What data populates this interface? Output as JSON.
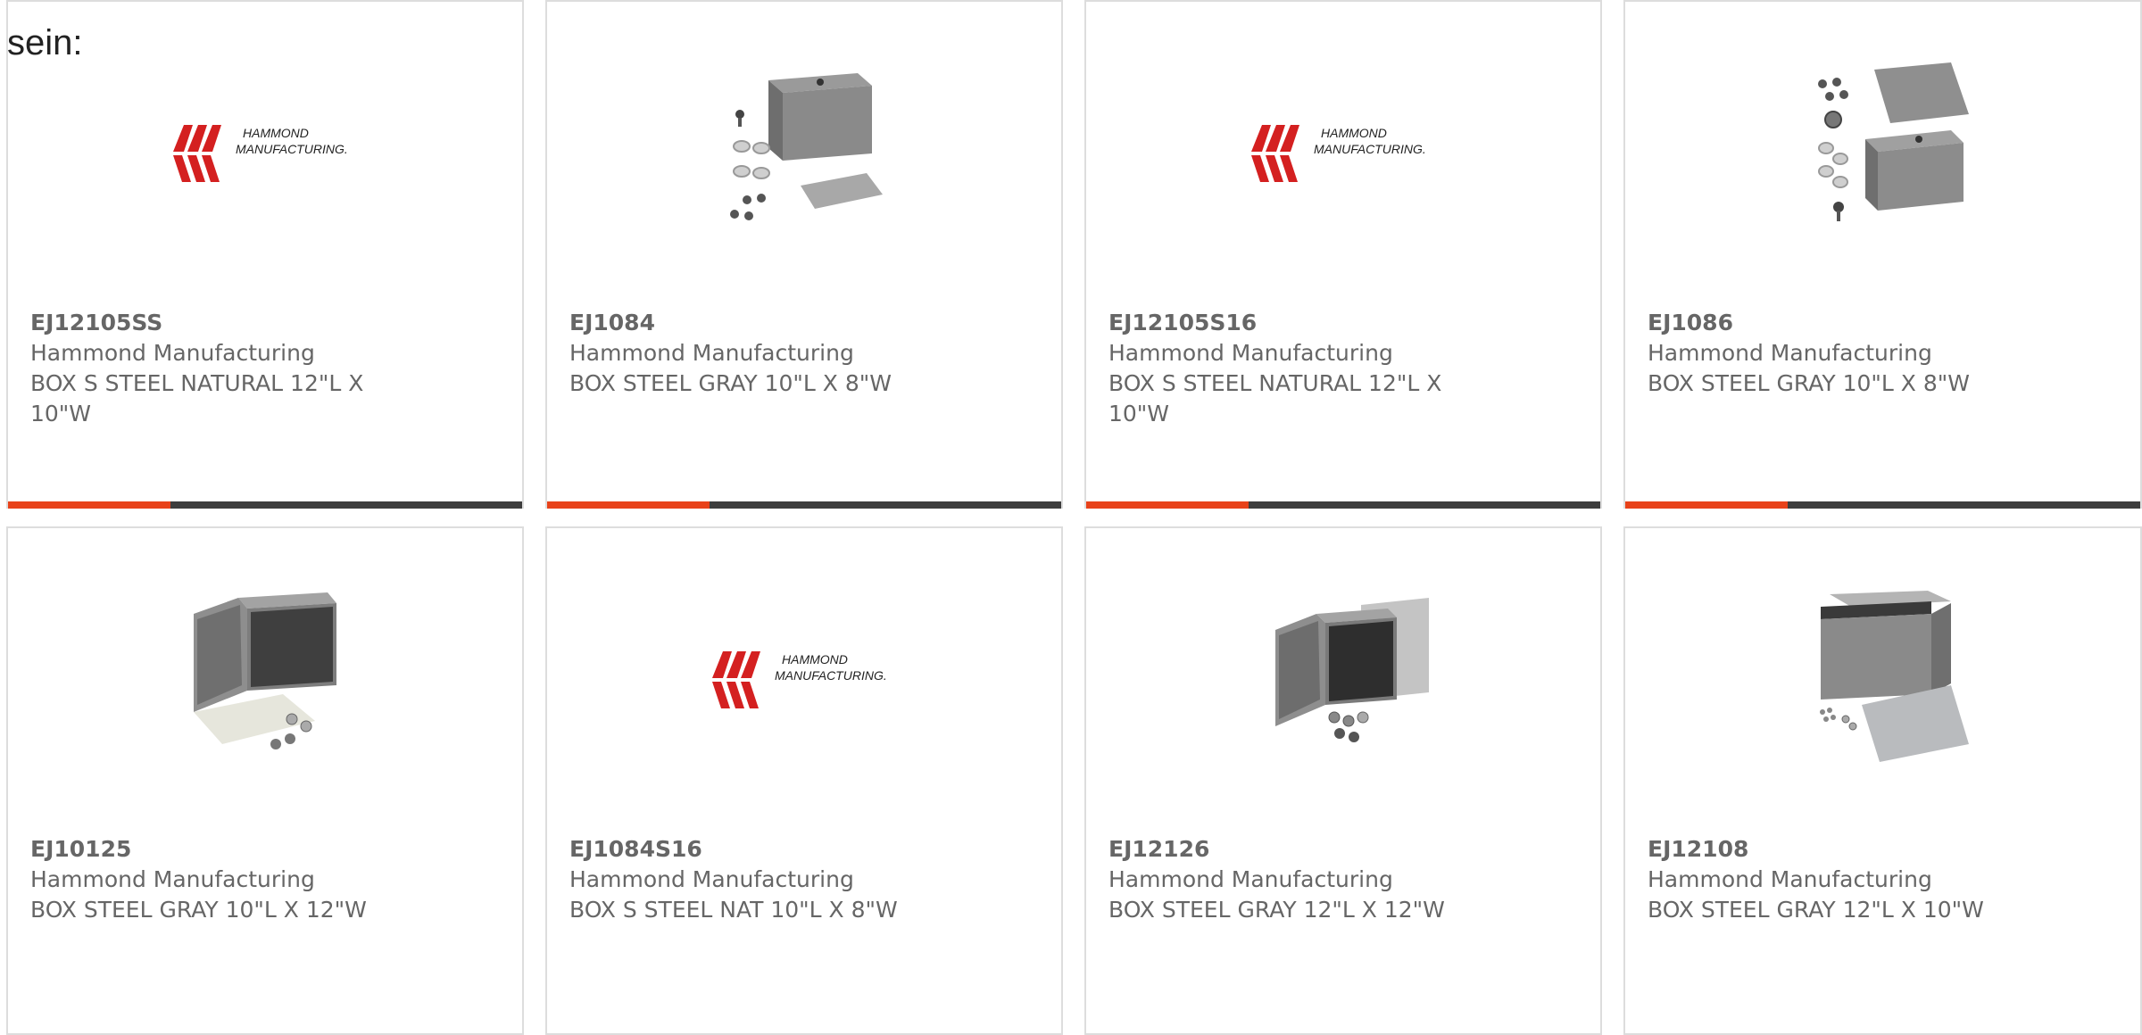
{
  "intro_text": "sein:",
  "colors": {
    "accent": "#e8421a",
    "bar": "#3d3d3d",
    "card_border": "#dddddd",
    "text": "#666666",
    "logo_red": "#d42020"
  },
  "logo": {
    "line1": "HAMMOND",
    "line2": "MANUFACTURING."
  },
  "products": [
    {
      "part": "EJ12105SS",
      "mfr": "Hammond Manufacturing",
      "desc": "BOX S STEEL NATURAL 12\"L X 10\"W",
      "image": "hammond-logo"
    },
    {
      "part": "EJ1084",
      "mfr": "Hammond Manufacturing",
      "desc": "BOX STEEL GRAY 10\"L X 8\"W",
      "image": "enclosure-kit"
    },
    {
      "part": "EJ12105S16",
      "mfr": "Hammond Manufacturing",
      "desc": "BOX S STEEL NATURAL 12\"L X 10\"W",
      "image": "hammond-logo"
    },
    {
      "part": "EJ1086",
      "mfr": "Hammond Manufacturing",
      "desc": "BOX STEEL GRAY 10\"L X 8\"W",
      "image": "enclosure-kit-tall"
    },
    {
      "part": "EJ10125",
      "mfr": "Hammond Manufacturing",
      "desc": "BOX STEEL GRAY 10\"L X 12\"W",
      "image": "enclosure-open-door"
    },
    {
      "part": "EJ1084S16",
      "mfr": "Hammond Manufacturing",
      "desc": "BOX S STEEL NAT 10\"L X 8\"W",
      "image": "hammond-logo"
    },
    {
      "part": "EJ12126",
      "mfr": "Hammond Manufacturing",
      "desc": "BOX STEEL GRAY 12\"L X 12\"W",
      "image": "enclosure-open-door-panel"
    },
    {
      "part": "EJ12108",
      "mfr": "Hammond Manufacturing",
      "desc": "BOX STEEL GRAY 12\"L X 10\"W",
      "image": "enclosure-lid-open"
    }
  ]
}
